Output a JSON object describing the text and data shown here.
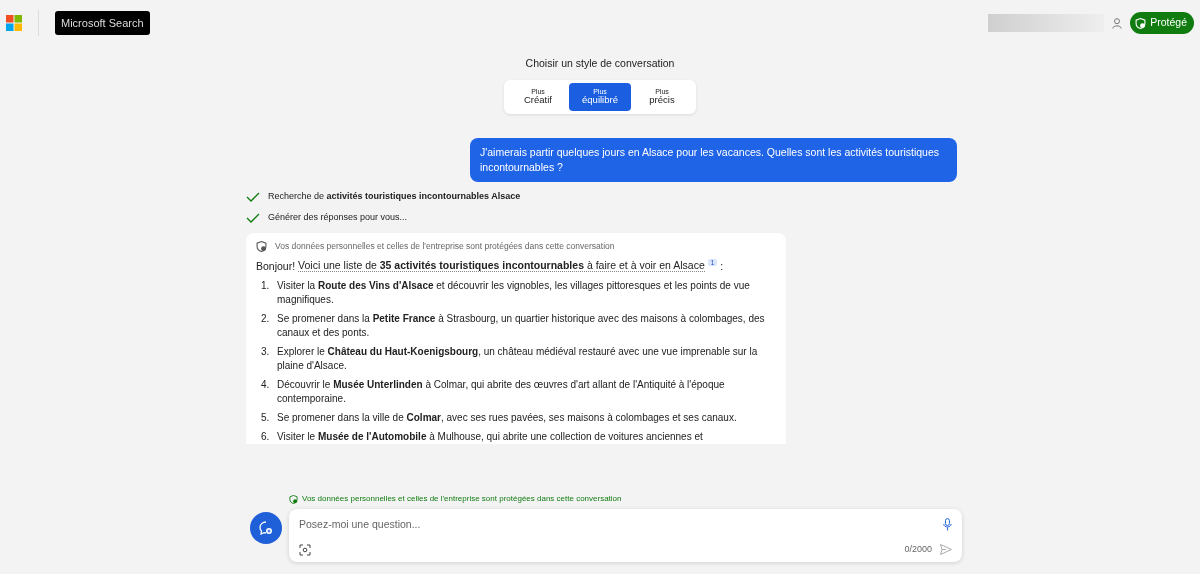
{
  "header": {
    "app_title": "Microsoft Search",
    "badge": "Protégé"
  },
  "style_picker": {
    "title": "Choisir un style de conversation",
    "options": [
      {
        "prefix": "Plus",
        "label": "Créatif",
        "selected": false
      },
      {
        "prefix": "Plus",
        "label": "équilibré",
        "selected": true
      },
      {
        "prefix": "Plus",
        "label": "précis",
        "selected": false
      }
    ]
  },
  "user_message": "J'aimerais partir quelques jours en Alsace pour les vacances. Quelles sont les activités touristiques incontournables ?",
  "progress": [
    {
      "text": "Recherche de **activités touristiques incontournables Alsace**",
      "done": true
    },
    {
      "text": "Générer des réponses pour vous...",
      "done": true
    }
  ],
  "answer": {
    "notice": "Vos données personnelles et celles de l'entreprise sont protégées dans cette conversation",
    "greeting": "Bonjour!",
    "cited_text": "Voici une liste de **35 activités touristiques incontournables** à faire et à voir en Alsace",
    "citation": "1",
    "after_citation": ":",
    "items": [
      {
        "number": "1.",
        "text": "Visiter la **Route des Vins d'Alsace** et découvrir les vignobles, les villages pittoresques et les points de vue magnifiques."
      },
      {
        "number": "2.",
        "text": "Se promener dans la **Petite France** à Strasbourg, un quartier historique avec des maisons à colombages, des canaux et des ponts."
      },
      {
        "number": "3.",
        "text": "Explorer le **Château du Haut-Koenigsbourg**, un château médiéval restauré avec une vue imprenable sur la plaine d'Alsace."
      },
      {
        "number": "4.",
        "text": "Découvrir le **Musée Unterlinden** à Colmar, qui abrite des œuvres d'art allant de l'Antiquité à l'époque contemporaine."
      },
      {
        "number": "5.",
        "text": "Se promener dans la ville de **Colmar**, avec ses rues pavées, ses maisons à colombages et ses canaux."
      },
      {
        "number": "6.",
        "text": "Visiter le **Musée de l'Automobile** à Mulhouse, qui abrite une collection de voitures anciennes et"
      }
    ]
  },
  "composer": {
    "notice": "Vos données personnelles et celles de l'entreprise sont protégées dans cette conversation",
    "placeholder": "Posez-moi une question...",
    "counter": "0/2000"
  }
}
